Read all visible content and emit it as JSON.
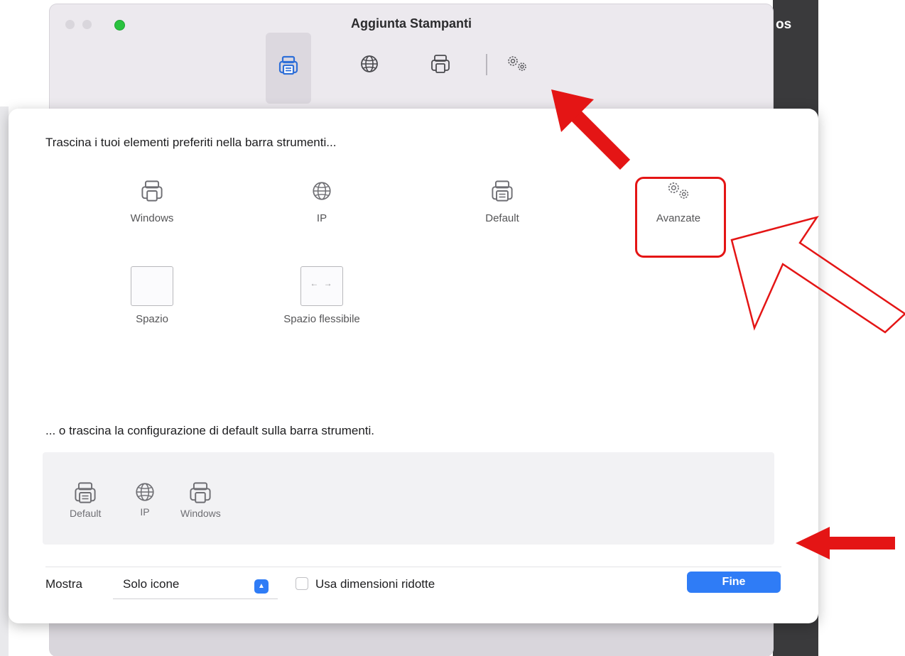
{
  "desktop": {
    "partial_label": "os"
  },
  "window": {
    "title": "Aggiunta Stampanti",
    "toolbar": [
      {
        "icon": "printer-icon",
        "selected": true
      },
      {
        "icon": "globe-icon",
        "selected": false
      },
      {
        "icon": "printer-icon",
        "selected": false
      },
      {
        "icon": "gears-icon",
        "selected": false
      }
    ]
  },
  "customize": {
    "instruction_top": "Trascina i tuoi elementi preferiti nella barra strumenti...",
    "palette": [
      {
        "label": "Windows",
        "icon": "printer-icon"
      },
      {
        "label": "IP",
        "icon": "globe-icon"
      },
      {
        "label": "Default",
        "icon": "printer-icon"
      },
      {
        "label": "Avanzate",
        "icon": "gears-icon"
      },
      {
        "label": "Spazio",
        "icon": "space-placeholder"
      },
      {
        "label": "Spazio flessibile",
        "icon": "flexible-space-placeholder"
      }
    ],
    "instruction_bottom": "... o trascina la configurazione di default sulla barra strumenti.",
    "default_set": [
      {
        "label": "Default",
        "icon": "printer-icon"
      },
      {
        "label": "IP",
        "icon": "globe-icon"
      },
      {
        "label": "Windows",
        "icon": "printer-icon"
      }
    ],
    "footer": {
      "show_label": "Mostra",
      "show_value": "Solo icone",
      "checkbox_label": "Usa dimensioni ridotte",
      "checkbox_checked": false,
      "done_label": "Fine"
    }
  },
  "colors": {
    "accent": "#2f7cf6",
    "annotation_red": "#e41515",
    "traffic_green": "#2ac23f"
  }
}
